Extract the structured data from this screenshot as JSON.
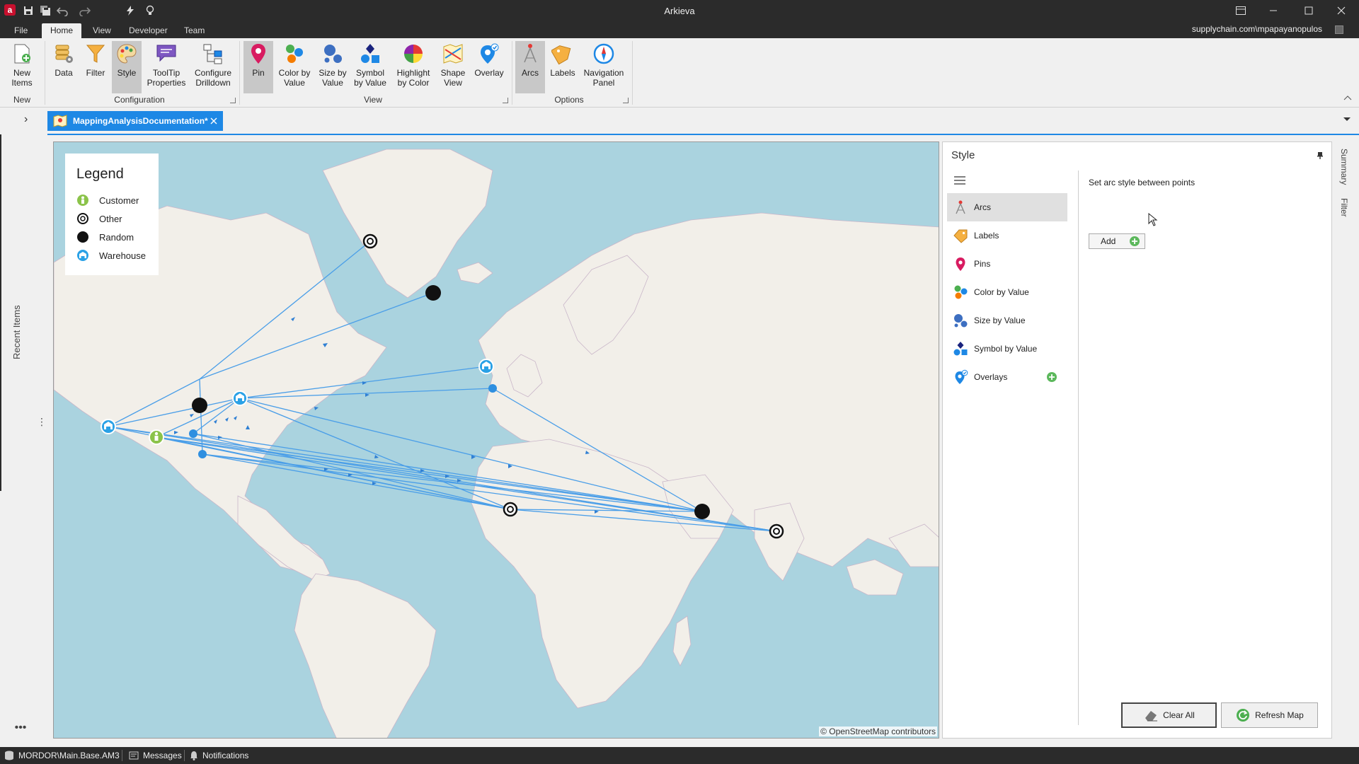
{
  "window": {
    "title": "Arkieva",
    "logo_letter": "a"
  },
  "menu": {
    "tabs": [
      {
        "label": "File"
      },
      {
        "label": "Home"
      },
      {
        "label": "View"
      },
      {
        "label": "Developer"
      },
      {
        "label": "Team"
      }
    ],
    "active_tab": "Home",
    "account": "supplychain.com\\mpapayanopulos"
  },
  "ribbon": {
    "groups": {
      "new": "New",
      "configuration": "Configuration",
      "view": "View",
      "options": "Options"
    },
    "buttons": {
      "new_items": "New Items",
      "data": "Data",
      "filter": "Filter",
      "style": "Style",
      "tooltip_l1": "ToolTip",
      "tooltip_l2": "Properties",
      "drill_l1": "Configure",
      "drill_l2": "Drilldown",
      "pin": "Pin",
      "color_l1": "Color by",
      "color_l2": "Value",
      "size_l1": "Size by",
      "size_l2": "Value",
      "symbol_l1": "Symbol",
      "symbol_l2": "by Value",
      "highlight_l1": "Highlight",
      "highlight_l2": "by Color",
      "shape_l1": "Shape",
      "shape_l2": "View",
      "overlay": "Overlay",
      "arcs": "Arcs",
      "labels": "Labels",
      "nav_l1": "Navigation",
      "nav_l2": "Panel"
    }
  },
  "document_tab": {
    "label": "MappingAnalysisDocumentation*"
  },
  "left_rail": {
    "recent_items": "Recent Items"
  },
  "legend": {
    "title": "Legend",
    "items": [
      {
        "label": "Customer",
        "symbol": "customer-icon"
      },
      {
        "label": "Other",
        "symbol": "ring-icon"
      },
      {
        "label": "Random",
        "symbol": "dot-icon"
      },
      {
        "label": "Warehouse",
        "symbol": "warehouse-icon"
      }
    ]
  },
  "map": {
    "attribution": "© OpenStreetMap contributors"
  },
  "style_panel": {
    "title": "Style",
    "items": [
      {
        "label": "Arcs",
        "icon": "arcs-icon"
      },
      {
        "label": "Labels",
        "icon": "tag-icon"
      },
      {
        "label": "Pins",
        "icon": "pin-icon"
      },
      {
        "label": "Color by Value",
        "icon": "color-dots-icon"
      },
      {
        "label": "Size by Value",
        "icon": "size-dots-icon"
      },
      {
        "label": "Symbol by Value",
        "icon": "symbols-icon"
      },
      {
        "label": "Overlays",
        "icon": "overlay-icon"
      }
    ],
    "selected": "Arcs",
    "hint": "Set arc style between points",
    "add_label": "Add",
    "clear_all": "Clear All",
    "refresh_map": "Refresh Map"
  },
  "right_rail": {
    "summary": "Summary",
    "filter": "Filter"
  },
  "status_bar": {
    "database": "MORDOR\\Main.Base.AM3",
    "messages": "Messages",
    "notifications": "Notifications"
  },
  "colors": {
    "chrome_dark": "#2b2b2b",
    "accent_blue": "#1e88e5",
    "arc_blue": "#4a9ee8",
    "customer_green": "#8bc34a",
    "sea": "#aad3df",
    "land": "#f2efe9"
  }
}
